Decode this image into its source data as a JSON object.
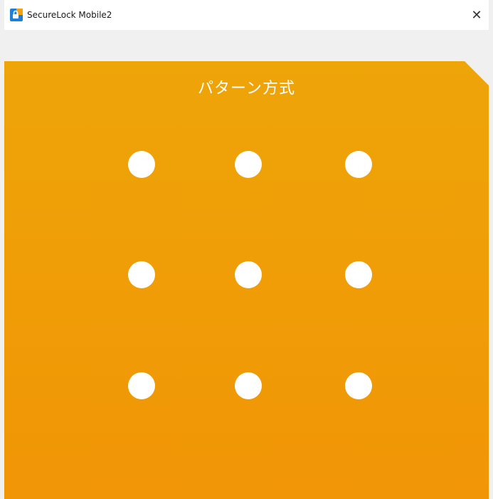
{
  "window": {
    "title": "SecureLock Mobile2",
    "close_icon": "close-icon",
    "app_icon": "securelock-app-icon"
  },
  "panel": {
    "title": "パターン方式",
    "accent_color": "#f19a06",
    "dot_color": "#ffffff"
  },
  "pattern_grid": {
    "rows": 3,
    "columns": 3,
    "dots": [
      {
        "id": "1"
      },
      {
        "id": "2"
      },
      {
        "id": "3"
      },
      {
        "id": "4"
      },
      {
        "id": "5"
      },
      {
        "id": "6"
      },
      {
        "id": "7"
      },
      {
        "id": "8"
      },
      {
        "id": "9"
      }
    ]
  }
}
